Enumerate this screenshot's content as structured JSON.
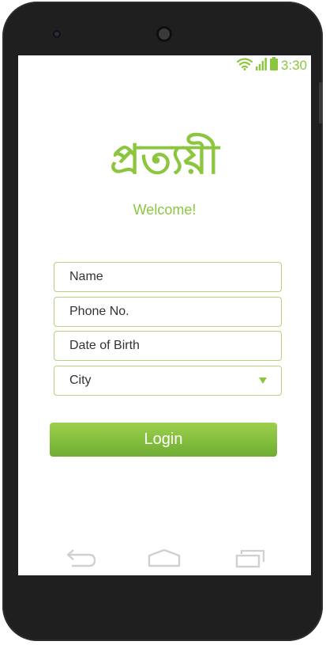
{
  "status_bar": {
    "time": "3:30",
    "wifi_icon": "wifi-icon",
    "signal_icon": "signal-icon",
    "battery_icon": "battery-icon"
  },
  "app": {
    "logo_text": "প্রত্যয়ী",
    "welcome": "Welcome!"
  },
  "form": {
    "name_placeholder": "Name",
    "phone_placeholder": "Phone No.",
    "dob_placeholder": "Date of Birth",
    "city_selected": "City",
    "login_label": "Login"
  },
  "nav": {
    "back_icon": "back-icon",
    "home_icon": "home-icon",
    "recents_icon": "recents-icon"
  },
  "colors": {
    "accent": "#8cc63f",
    "field_border": "#b3d17f",
    "button_top": "#9cd04c",
    "button_bottom": "#6fad33",
    "phone_body": "#1f1f1f"
  }
}
